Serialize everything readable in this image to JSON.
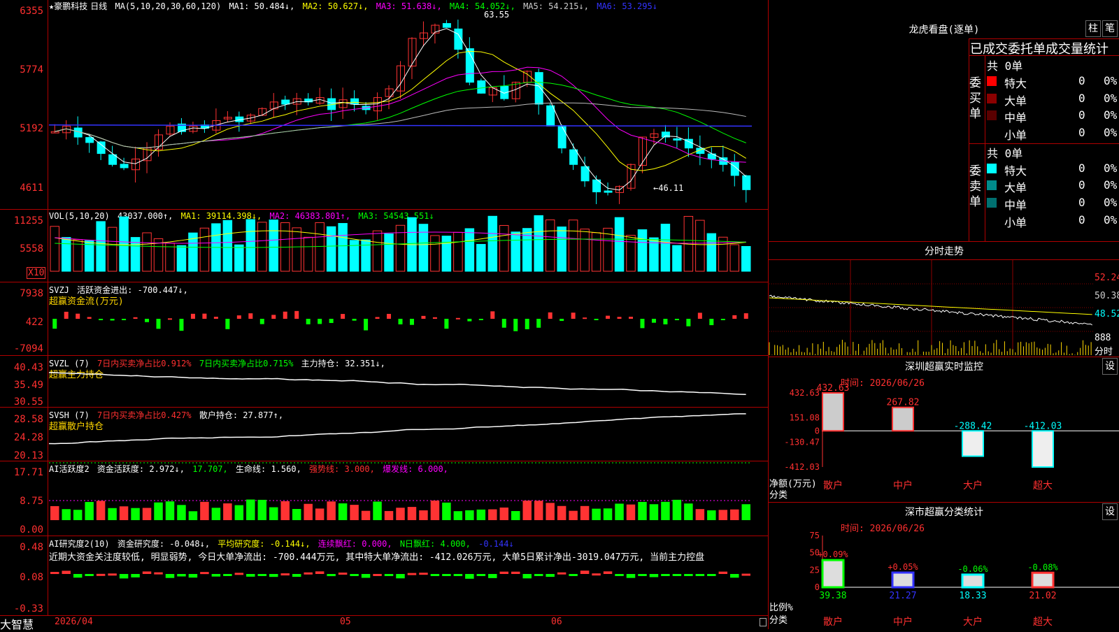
{
  "colors": {
    "up": "#ff3333",
    "down": "#00ffff",
    "green": "#00ff00",
    "grid": "#8b0000",
    "white": "#ffffff",
    "yellow": "#ffff00",
    "magenta": "#ff00ff",
    "blue": "#3333ff"
  },
  "kline": {
    "title": "★豪鹏科技",
    "period": "日线",
    "ma_params": "MA(5,10,20,30,60,120)",
    "ma1": "MA1: 50.484↓,",
    "ma2": "MA2: 50.627↓,",
    "ma3": "MA3: 51.638↓,",
    "ma4": "MA4: 54.052↓,",
    "ma5": "MA5: 54.215↓,",
    "ma6": "MA6: 53.295↓",
    "yticks": [
      "6355",
      "5774",
      "5192",
      "4611"
    ],
    "high_label": "63.55",
    "low_label": "←46.11"
  },
  "vol": {
    "label": "VOL(5,10,20)",
    "value": "43037.000↑,",
    "ma1": "MA1: 39114.398↓,",
    "ma2": "MA2: 46383.801↑,",
    "ma3": "MA3: 54543.551↓",
    "yticks": [
      "11255",
      "5558"
    ],
    "unit": "X10"
  },
  "svzj": {
    "label": "SVZJ",
    "desc": "活跃资金进出: -700.447↓,",
    "sub": "超赢资金流(万元)",
    "yticks": [
      "7938",
      "422",
      "-7094"
    ]
  },
  "svzl": {
    "label": "SVZL (7)",
    "t1": "7日内买卖净占比0.912%",
    "t2": "7日内买卖净占比0.715%",
    "t3": "主力持仓: 32.351↓,",
    "sub": "超赢主力持仓",
    "yticks": [
      "40.43",
      "35.49",
      "30.55"
    ]
  },
  "svsh": {
    "label": "SVSH (7)",
    "t1": "7日内买卖净占比0.427%",
    "t2": "散户持仓: 27.877↑,",
    "sub": "超赢散户持仓",
    "yticks": [
      "28.58",
      "24.28",
      "20.13"
    ]
  },
  "ai1": {
    "label": "AI活跃度2",
    "t1": "资金活跃度: 2.972↓,",
    "t2": "17.707,",
    "t3": "生命线: 1.560,",
    "t4": "强势线: 3.000,",
    "t5": "爆发线: 6.000,",
    "yticks": [
      "17.71",
      "8.75",
      "0.00"
    ]
  },
  "ai2": {
    "label": "AI研究度2(10)",
    "t1": "资金研究度: -0.048↓,",
    "t2": "平均研究度: -0.144↓,",
    "t3": "连续飘红: 0.000,",
    "t4": "N日飘红: 4.000,",
    "t5": "-0.144↓",
    "comment": "近期大资金关注度较低, 明显弱势, 今日大单净流出: -700.444万元, 其中特大单净流出: -412.026万元, 大单5日累计净出-3019.047万元, 当前主力控盘",
    "yticks": [
      "0.48",
      "0.08",
      "-0.33"
    ]
  },
  "footer": {
    "brand": "大智慧",
    "dates": [
      "2026/04",
      "05",
      "06"
    ]
  },
  "right": {
    "lhb_title": "龙虎看盘(逐单)",
    "btn_zhu": "柱",
    "btn_bi": "笔",
    "stat_title": "已成交委托单成交量统计",
    "buy_label": "委买单",
    "sell_label": "委卖单",
    "buy_total": "共 0单",
    "sell_total": "共 0单",
    "rows": [
      {
        "name": "特大",
        "num": "0",
        "pct": "0%"
      },
      {
        "name": "大单",
        "num": "0",
        "pct": "0%"
      },
      {
        "name": "中单",
        "num": "0",
        "pct": "0%"
      },
      {
        "name": "小单",
        "num": "0",
        "pct": "0%"
      }
    ],
    "fs_title": "分时走势",
    "fs_yticks": [
      "52.24",
      "50.38",
      "48.52"
    ],
    "fs_vol": "888",
    "fs_fen": "分时",
    "mon_title": "深圳超赢实时监控",
    "mon_set": "设",
    "mon_time": "时间: 2026/06/26",
    "mon_yticks": [
      "432.63",
      "151.08",
      "0",
      "-130.47",
      "-412.03"
    ],
    "mon_side": "净额(万元)",
    "mon_cat": "分类",
    "cls_title": "深市超赢分类统计",
    "cls_set": "设",
    "cls_time": "时间: 2026/06/26",
    "cls_yticks": [
      "75",
      "50",
      "25",
      "0"
    ],
    "cls_side": "比例%",
    "cls_cat": "分类"
  },
  "chart_data": [
    {
      "type": "bar",
      "title": "深圳超赢实时监控",
      "categories": [
        "散户",
        "中户",
        "大户",
        "超大"
      ],
      "values": [
        432.63,
        267.82,
        -288.42,
        -412.03
      ],
      "ylabel": "净额(万元)",
      "ylim": [
        -412.03,
        432.63
      ]
    },
    {
      "type": "bar",
      "title": "深市超赢分类统计",
      "categories": [
        "散户",
        "中户",
        "大户",
        "超大"
      ],
      "values": [
        39.38,
        21.27,
        18.33,
        21.02
      ],
      "changes": [
        "+0.09%",
        "+0.05%",
        "-0.06%",
        "-0.08%"
      ],
      "ylabel": "比例%",
      "ylim": [
        0,
        75
      ]
    }
  ]
}
